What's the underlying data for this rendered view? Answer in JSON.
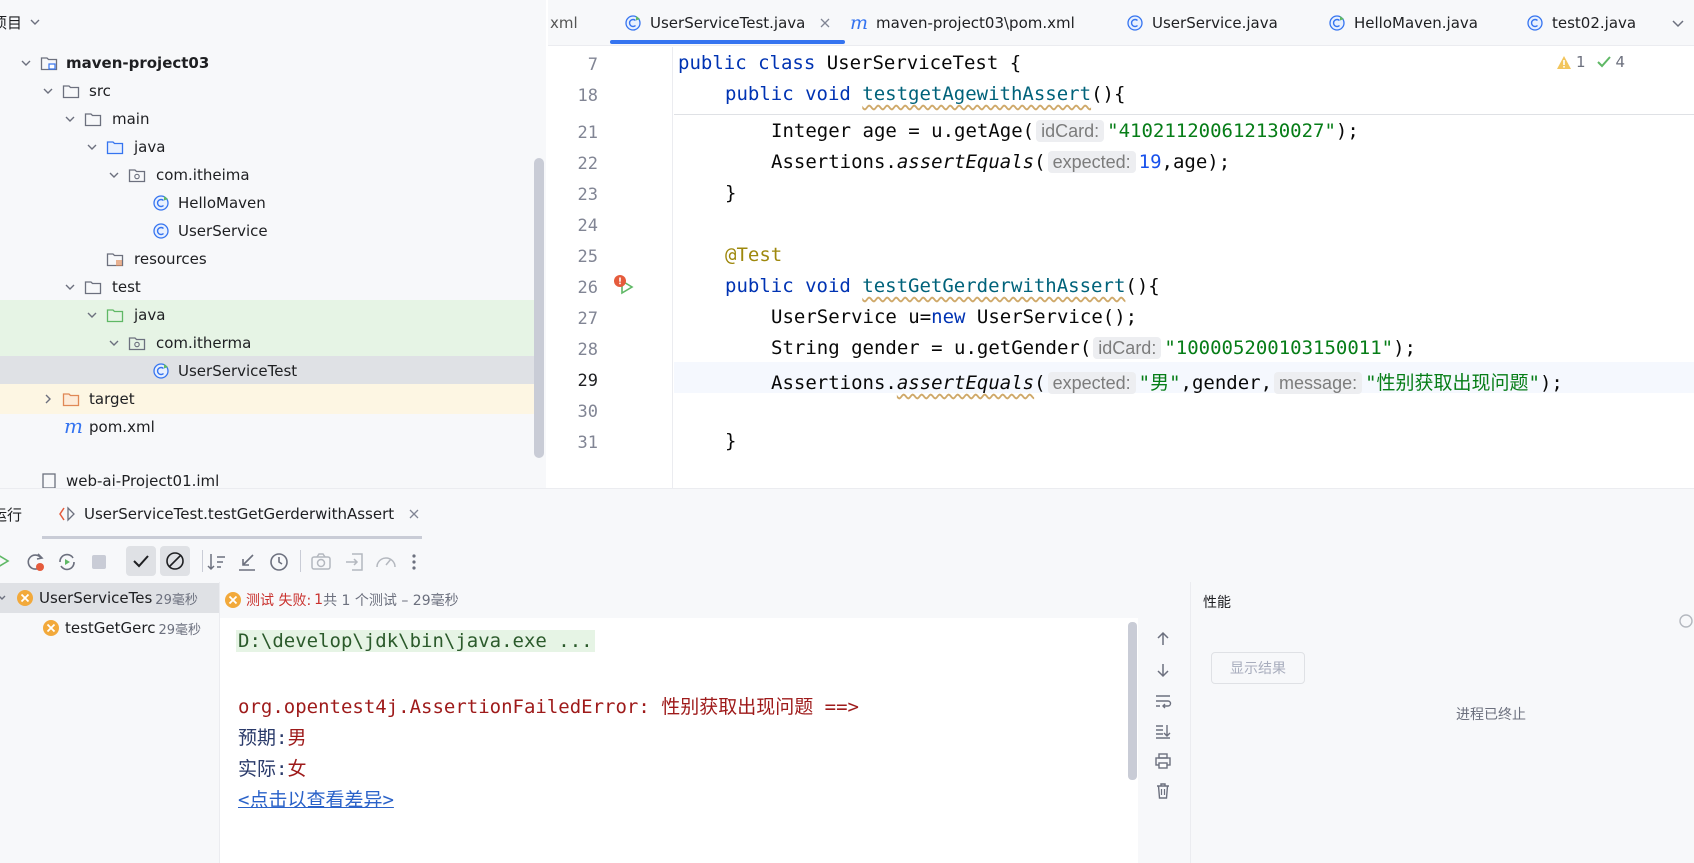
{
  "project": {
    "header_label": "项目",
    "tree": [
      {
        "label": "maven-project03",
        "bold": true
      },
      {
        "label": "src"
      },
      {
        "label": "main"
      },
      {
        "label": "java"
      },
      {
        "label": "com.itheima"
      },
      {
        "label": "HelloMaven"
      },
      {
        "label": "UserService"
      },
      {
        "label": "resources"
      },
      {
        "label": "test"
      },
      {
        "label": "java"
      },
      {
        "label": "com.itherma"
      },
      {
        "label": "UserServiceTest"
      },
      {
        "label": "target"
      },
      {
        "label": "pom.xml"
      },
      {
        "label": "web-ai-Project01.iml"
      }
    ]
  },
  "editor": {
    "tabs": [
      {
        "label": "xml"
      },
      {
        "label": "UserServiceTest.java",
        "active": true
      },
      {
        "label": "maven-project03\\pom.xml"
      },
      {
        "label": "UserService.java"
      },
      {
        "label": "HelloMaven.java"
      },
      {
        "label": "test02.java"
      }
    ],
    "inspections": {
      "warnings": "1",
      "ok": "4"
    },
    "line_numbers": [
      "7",
      "18",
      "21",
      "22",
      "23",
      "24",
      "25",
      "26",
      "27",
      "28",
      "29",
      "30",
      "31"
    ],
    "code": {
      "l7_kw1": "public class ",
      "l7_name": "UserServiceTest {",
      "l18_kw": "public void ",
      "l18_fn": "testgetAgewithAssert",
      "l18_rest": "(){",
      "l21_a": "Integer age = u.getAge(",
      "l21_hint": "idCard:",
      "l21_str": "\"410211200612130027\"",
      "l21_end": ");",
      "l22_a": "Assertions.",
      "l22_m": "assertEquals",
      "l22_b": "(",
      "l22_hint": "expected:",
      "l22_num": "19",
      "l22_end": ",age);",
      "l23": "}",
      "l25": "@Test",
      "l26_kw": "public void ",
      "l26_fn": "testGetGerderwithAssert",
      "l26_rest": "(){",
      "l27_a": "UserService u=",
      "l27_kw": "new",
      "l27_b": " UserService();",
      "l28_a": "String gender = u.getGender(",
      "l28_hint": "idCard:",
      "l28_str": "\"100005200103150011\"",
      "l28_end": ");",
      "l29_a": "Assertions.",
      "l29_m": "assertEquals",
      "l29_b": "(",
      "l29_hint1": "expected:",
      "l29_str1": "\"男\"",
      "l29_mid": ",gender,",
      "l29_hint2": "message:",
      "l29_str2": "\"性别获取出现问题\"",
      "l29_end": ");",
      "l31": "}"
    }
  },
  "run": {
    "tool_label": "运行",
    "config_tab": "UserServiceTest.testGetGerderwithAssert",
    "status_prefix": "测试 失败:",
    "status_count": "1",
    "status_rest": "共 1 个测试 – 29毫秒",
    "tests": [
      {
        "name": "UserServiceTes",
        "time": "29毫秒"
      },
      {
        "name": "testGetGerc",
        "time": "29毫秒"
      }
    ],
    "console": {
      "cmd": "D:\\develop\\jdk\\bin\\java.exe ...",
      "error": "org.opentest4j.AssertionFailedError: 性别获取出现问题 ==>",
      "expected_label": "预期:",
      "expected_val": "男",
      "actual_label": "实际:",
      "actual_val": "女",
      "diff_link": "<点击以查看差异>"
    },
    "perf": {
      "title": "性能",
      "show_results": "显示结果",
      "terminated": "进程已终止"
    }
  },
  "colors": {
    "accent": "#3574f0",
    "error": "#e55b3c",
    "folder_green_bg": "#e6f4e5",
    "selected_bg": "#dfe1e5",
    "target_bg": "#fdf6e3"
  }
}
